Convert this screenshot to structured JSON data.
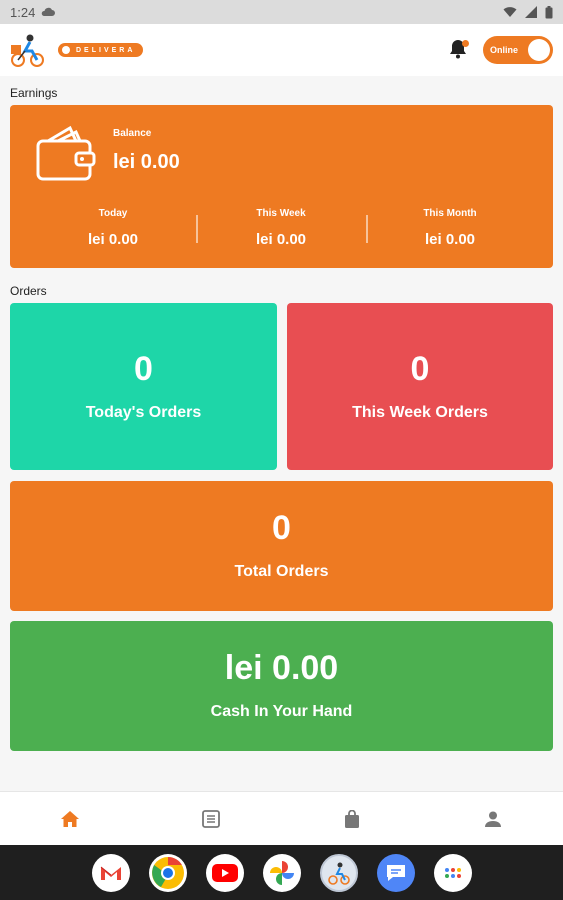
{
  "status_bar": {
    "time": "1:24"
  },
  "header": {
    "toggle_label": "Online",
    "brand_text": "DELIVERA"
  },
  "earnings": {
    "section_label": "Earnings",
    "balance_label": "Balance",
    "balance_value": "lei 0.00",
    "today_label": "Today",
    "today_value": "lei 0.00",
    "week_label": "This Week",
    "week_value": "lei 0.00",
    "month_label": "This Month",
    "month_value": "lei 0.00"
  },
  "orders": {
    "section_label": "Orders",
    "today_count": "0",
    "today_label": "Today's Orders",
    "week_count": "0",
    "week_label": "This Week Orders",
    "total_count": "0",
    "total_label": "Total Orders"
  },
  "cash": {
    "value": "lei 0.00",
    "label": "Cash In Your Hand"
  },
  "bottom_nav": [
    {
      "icon": "home-icon",
      "active": true
    },
    {
      "icon": "orders-list-icon",
      "active": false
    },
    {
      "icon": "shopping-bag-icon",
      "active": false
    },
    {
      "icon": "profile-icon",
      "active": false
    }
  ],
  "colors": {
    "primary": "#ee7a22",
    "teal": "#1ed6a8",
    "red": "#e84e52",
    "green": "#4caf50"
  }
}
